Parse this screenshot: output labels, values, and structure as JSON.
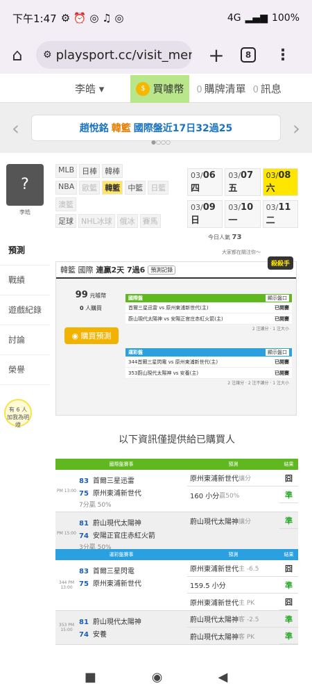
{
  "status": {
    "time": "下午1:47",
    "icons": "⚙ ⏰ ◎ ♫ ◎",
    "network": "4G",
    "battery": "100%"
  },
  "browser": {
    "url": "playsport.cc/visit_mer",
    "tab_count": "8"
  },
  "topnav": {
    "user": "李皓 ▾",
    "buy": "買噱幣",
    "cart_count": "0",
    "cart": "購牌清單",
    "msg_count": "0",
    "msg": "訊息"
  },
  "banner": {
    "name": "趙悅銘",
    "league": "韓籃",
    "text": "國際盤近17日32過25"
  },
  "sidebar": {
    "avatar_name": "李皓",
    "items": [
      "預測",
      "戰績",
      "遊戲紀錄",
      "討論",
      "榮譽"
    ],
    "bulb_text": "有 6 人\n加我為明燈"
  },
  "sports": {
    "row1": [
      "MLB",
      "日棒",
      "韓棒"
    ],
    "row2": [
      "NBA",
      "歐籃",
      "韓籃",
      "中籃",
      "日籃"
    ],
    "row3": [
      "澳籃"
    ],
    "row4": [
      "足球",
      "NHL冰球",
      "俄冰",
      "賽馬"
    ]
  },
  "dates": {
    "row1": [
      {
        "d": "03/",
        "n": "06 四"
      },
      {
        "d": "03/",
        "n": "07 五"
      },
      {
        "d": "03/",
        "n": "08 六"
      }
    ],
    "row2": [
      {
        "d": "03/",
        "n": "09 日"
      },
      {
        "d": "03/",
        "n": "10 一"
      },
      {
        "d": "03/",
        "n": "11 二"
      }
    ]
  },
  "visitors": {
    "label": "今日人氣",
    "count": "73",
    "sub": "大家都在關注你～"
  },
  "panel": {
    "title_league": "韓籃 國際",
    "title_streak": "連贏2天 7過6",
    "rec_btn": "預測記錄",
    "badge": "殺殺手",
    "price": "99",
    "price_unit": "元噱幣",
    "buyers": "0",
    "buyers_unit": "人購買",
    "buy_btn": "購買預測",
    "t1_head": "國際盤",
    "t1_btn": "顯示盤口",
    "t1_rows": [
      {
        "g": "首爾三星迅雷 vs 原州東浦新世代(主)",
        "s": "已開賽"
      },
      {
        "g": "蔚山現代太陽神 vs 安陽正官庄赤紅火箭(主)",
        "s": "已開賽"
      }
    ],
    "t1_foot": "2 注讓分 · 1 注大小",
    "t2_head": "運彩盤",
    "t2_btn": "顯示盤口",
    "t2_rows": [
      {
        "id": "344",
        "g": "首爾三星閃電 vs 原州東浦新世代(主)",
        "s": "已開賽"
      },
      {
        "id": "353",
        "g": "蔚山現代太陽神 vs 安養(主)",
        "s": "已開賽"
      }
    ],
    "t2_foot": "2 注讓分 · 2 注不讓分 · 1 注大小"
  },
  "notice": "以下資訊僅提供給已購買人",
  "table1": {
    "headers": [
      "國際盤賽事",
      "預測",
      "結果"
    ],
    "blocks": [
      {
        "time": "PM 13:00",
        "t1n": "83",
        "t1": "首爾三星迅雷",
        "t2n": "75",
        "t2": "原州東浦新世代",
        "rate": "7分贏 50%",
        "preds": [
          {
            "p": "原州東浦新世代",
            "x": "讓分",
            "r": "囧"
          },
          {
            "p": "160 小分",
            "x": "贏50%",
            "r": "準"
          }
        ]
      },
      {
        "time": "PM 15:00",
        "t1n": "81",
        "t1": "蔚山現代太陽神",
        "t2n": "74",
        "t2": "安陽正官庄赤紅火箭",
        "rate": "3分贏 50%",
        "preds": [
          {
            "p": "蔚山現代太陽神",
            "x": "讓分",
            "r": "準"
          }
        ]
      }
    ]
  },
  "table2": {
    "headers": [
      "運彩盤賽事",
      "預測",
      "結果"
    ],
    "blocks": [
      {
        "id": "344",
        "time": "PM 13:00",
        "t1n": "83",
        "t1": "首爾三星閃電",
        "t2n": "75",
        "t2": "原州東浦新世代",
        "preds": [
          {
            "p": "原州東浦新世代",
            "x": "主 -6.5",
            "r": "囧"
          },
          {
            "p": "159.5 小分",
            "x": "",
            "r": "準"
          },
          {
            "p": "原州東浦新世代",
            "x": "主 PK",
            "r": "囧"
          }
        ]
      },
      {
        "id": "353",
        "time": "PM 15:00",
        "t1n": "81",
        "t1": "蔚山現代太陽神",
        "t2n": "74",
        "t2": "安養",
        "preds": [
          {
            "p": "蔚山現代太陽神",
            "x": "客 -2.5",
            "r": "準"
          },
          {
            "p": "蔚山現代太陽神",
            "x": "客 PK",
            "r": "準"
          }
        ]
      }
    ]
  },
  "colors": {
    "green": "#5fb81f",
    "blue": "#2aa0e0"
  }
}
